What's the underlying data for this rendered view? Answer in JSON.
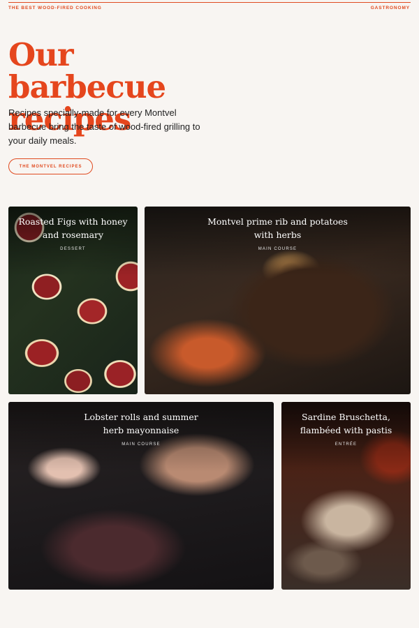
{
  "topbar": {
    "left_label": "THE BEST WOOD-FIRED COOKING",
    "right_label": "GASTRONOMY"
  },
  "hero": {
    "title": "Our barbecue recipes",
    "intro": "Recipes specially-made for every Montvel barbecue bring the taste of wood-fired grilling to your daily meals.",
    "cta_label": "THE MONTVEL RECIPES"
  },
  "recipes": [
    {
      "title": "Roasted Figs with honey and rosemary",
      "category": "DESSERT"
    },
    {
      "title": "Montvel prime rib and potatoes with herbs",
      "category": "MAIN COURSE"
    },
    {
      "title": "Lobster rolls and summer herb mayonnaise",
      "category": "MAIN COURSE"
    },
    {
      "title": "Sardine Bruschetta, flambéed with pastis",
      "category": "ENTRÉE"
    }
  ],
  "colors": {
    "accent": "#e5461d",
    "background": "#f8f5f2",
    "text": "#1c1c1c"
  }
}
